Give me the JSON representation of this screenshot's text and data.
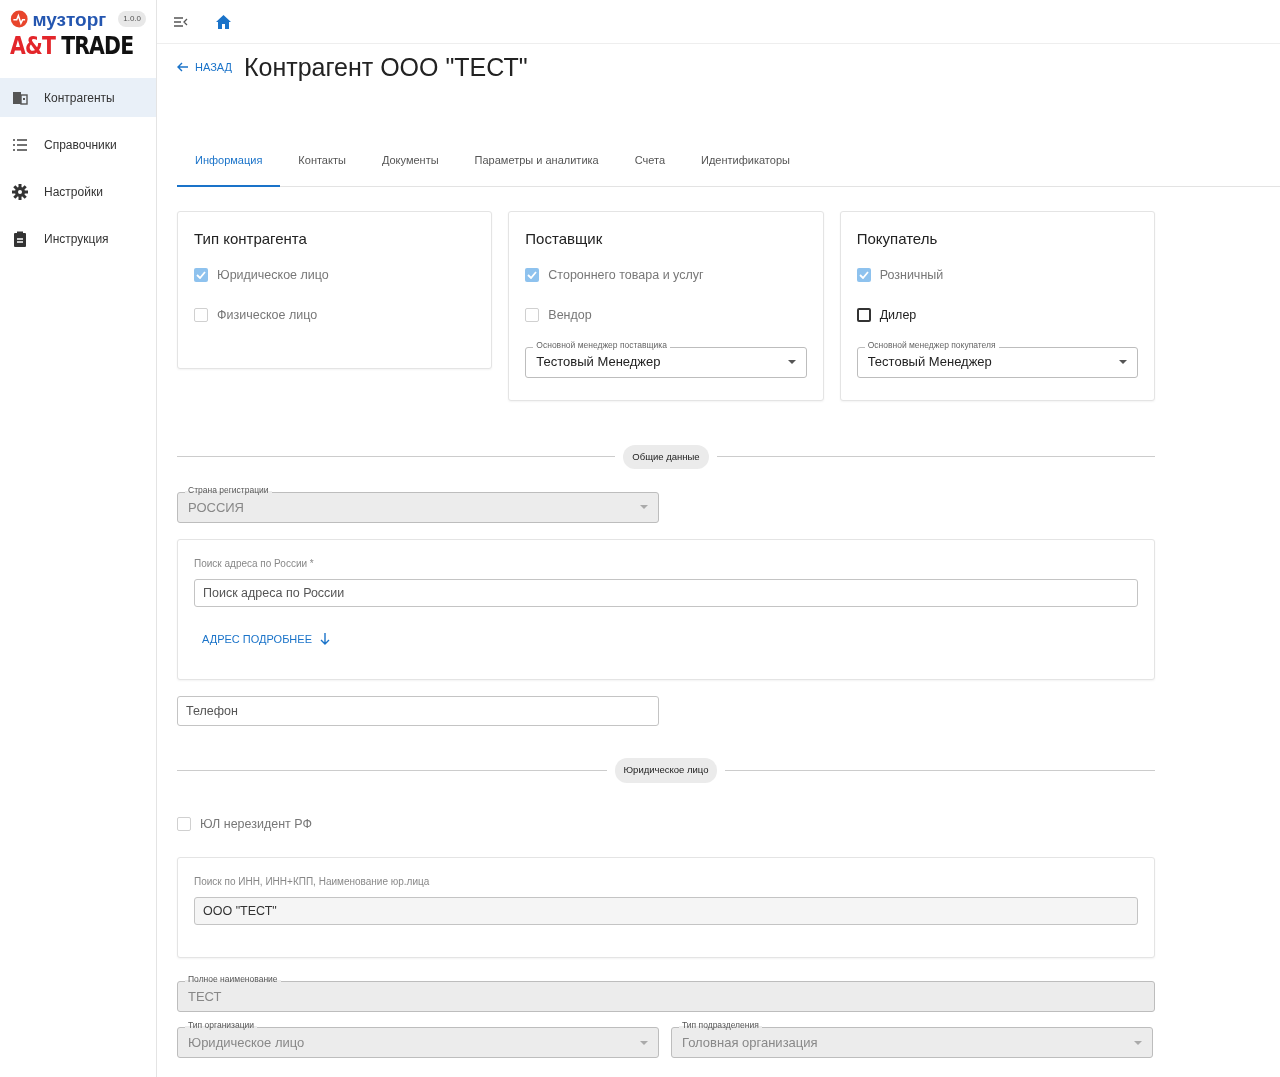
{
  "app": {
    "logo_name": "музторг",
    "version": "1.0.0",
    "brand_prefix": "A&T",
    "brand_suffix": "TRADE"
  },
  "sidebar": {
    "items": [
      {
        "label": "Контрагенты",
        "kind": "building",
        "selected": true
      },
      {
        "label": "Справочники",
        "kind": "list",
        "selected": false
      },
      {
        "label": "Настройки",
        "kind": "gear",
        "selected": false
      },
      {
        "label": "Инструкция",
        "kind": "clipboard",
        "selected": false
      }
    ]
  },
  "header": {
    "back_label": "НАЗАД",
    "title": "Контрагент ООО \"ТЕСТ\""
  },
  "tabs": [
    {
      "label": "Информация",
      "selected": true
    },
    {
      "label": "Контакты",
      "selected": false
    },
    {
      "label": "Документы",
      "selected": false
    },
    {
      "label": "Параметры и аналитика",
      "selected": false
    },
    {
      "label": "Счета",
      "selected": false
    },
    {
      "label": "Идентификаторы",
      "selected": false
    }
  ],
  "cards": [
    {
      "title": "Тип контрагента",
      "checkboxes": [
        {
          "label": "Юридическое лицо",
          "checked": true,
          "disabled": true
        },
        {
          "label": "Физическое лицо",
          "checked": false,
          "disabled": true
        }
      ]
    },
    {
      "title": "Поставщик",
      "checkboxes": [
        {
          "label": "Стороннего товара и услуг",
          "checked": true,
          "disabled": true
        },
        {
          "label": "Вендор",
          "checked": false,
          "disabled": true
        }
      ],
      "manager": {
        "label": "Основной менеджер поставщика",
        "value": "Тестовый Менеджер",
        "disabled": false
      }
    },
    {
      "title": "Покупатель",
      "checkboxes": [
        {
          "label": "Розничный",
          "checked": true,
          "disabled": true
        },
        {
          "label": "Дилер",
          "checked": false,
          "disabled": false
        }
      ],
      "manager": {
        "label": "Основной менеджер покупателя",
        "value": "Тестовый Менеджер",
        "disabled": false
      }
    }
  ],
  "general": {
    "divider": "Общие данные",
    "country": {
      "label": "Страна регистрации",
      "value": "РОССИЯ",
      "disabled": true
    },
    "address": {
      "label": "Поиск адреса по России *",
      "placeholder": "Поиск адреса по России",
      "more_link": "АДРЕС ПОДРОБНЕЕ"
    },
    "phone": {
      "placeholder": "Телефон"
    }
  },
  "legal": {
    "divider": "Юридическое лицо",
    "nonresident": {
      "label": "ЮЛ нерезидент РФ",
      "checked": false,
      "disabled": true
    },
    "inn_search": {
      "label": "Поиск по ИНН, ИНН+КПП, Наименование юр.лица",
      "value": "ООО \"ТЕСТ\""
    },
    "full_name": {
      "label": "Полное наименование",
      "value": "ТЕСТ",
      "disabled": true
    },
    "org_type": {
      "label": "Тип организации",
      "value": "Юридическое лицо",
      "disabled": true
    },
    "division_type": {
      "label": "Тип подразделения",
      "value": "Головная организация",
      "disabled": true
    }
  }
}
